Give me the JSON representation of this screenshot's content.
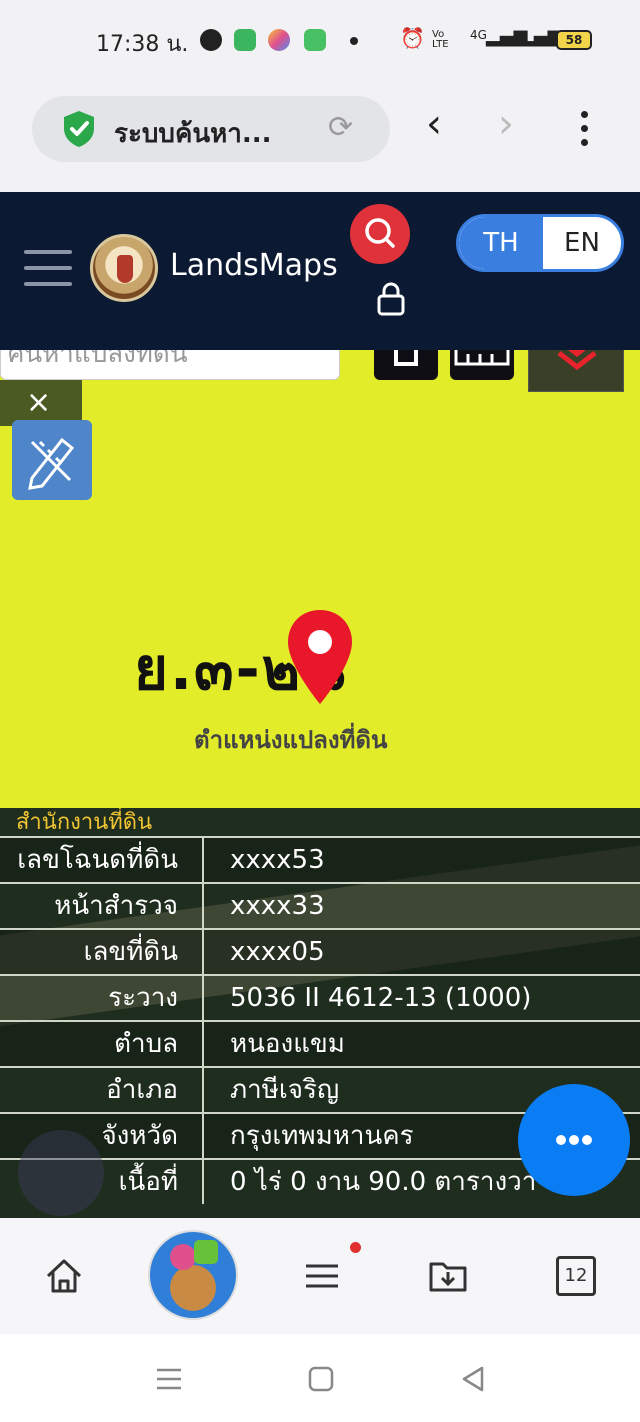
{
  "status_bar": {
    "time": "17:38 น.",
    "network": "4G",
    "battery": "58",
    "volte": "Vo LTE"
  },
  "browser": {
    "page_title": "ระบบค้นหา...",
    "reload_icon": "reload-icon",
    "secure_icon": "shield-check-icon"
  },
  "site": {
    "brand": "LandsMaps",
    "lang_th": "TH",
    "lang_en": "EN"
  },
  "map": {
    "search_placeholder": "ค้นหาแปลงที่ดิน",
    "close_symbol": "×",
    "parcel_code": "ย.๓-๒๘",
    "parcel_caption": "ตำแหน่งแปลงที่ดิน",
    "accent_color": "#e2ec28"
  },
  "parcel_info": {
    "office_label": "สำนักงานที่ดิน",
    "rows": [
      {
        "label": "เลขโฉนดที่ดิน",
        "value": "xxxx53"
      },
      {
        "label": "หน้าสำรวจ",
        "value": "xxxx33"
      },
      {
        "label": "เลขที่ดิน",
        "value": "xxxx05"
      },
      {
        "label": "ระวาง",
        "value": "5036 II 4612-13 (1000)"
      },
      {
        "label": "ตำบล",
        "value": "หนองแขม"
      },
      {
        "label": "อำเภอ",
        "value": "ภาษีเจริญ"
      },
      {
        "label": "จังหวัด",
        "value": "กรุงเทพมหานคร"
      },
      {
        "label": "เนื้อที่",
        "value": "0 ไร่ 0 งาน 90.0 ตารางวา"
      }
    ]
  },
  "bottom_toolbar": {
    "tabs_count": "12"
  }
}
